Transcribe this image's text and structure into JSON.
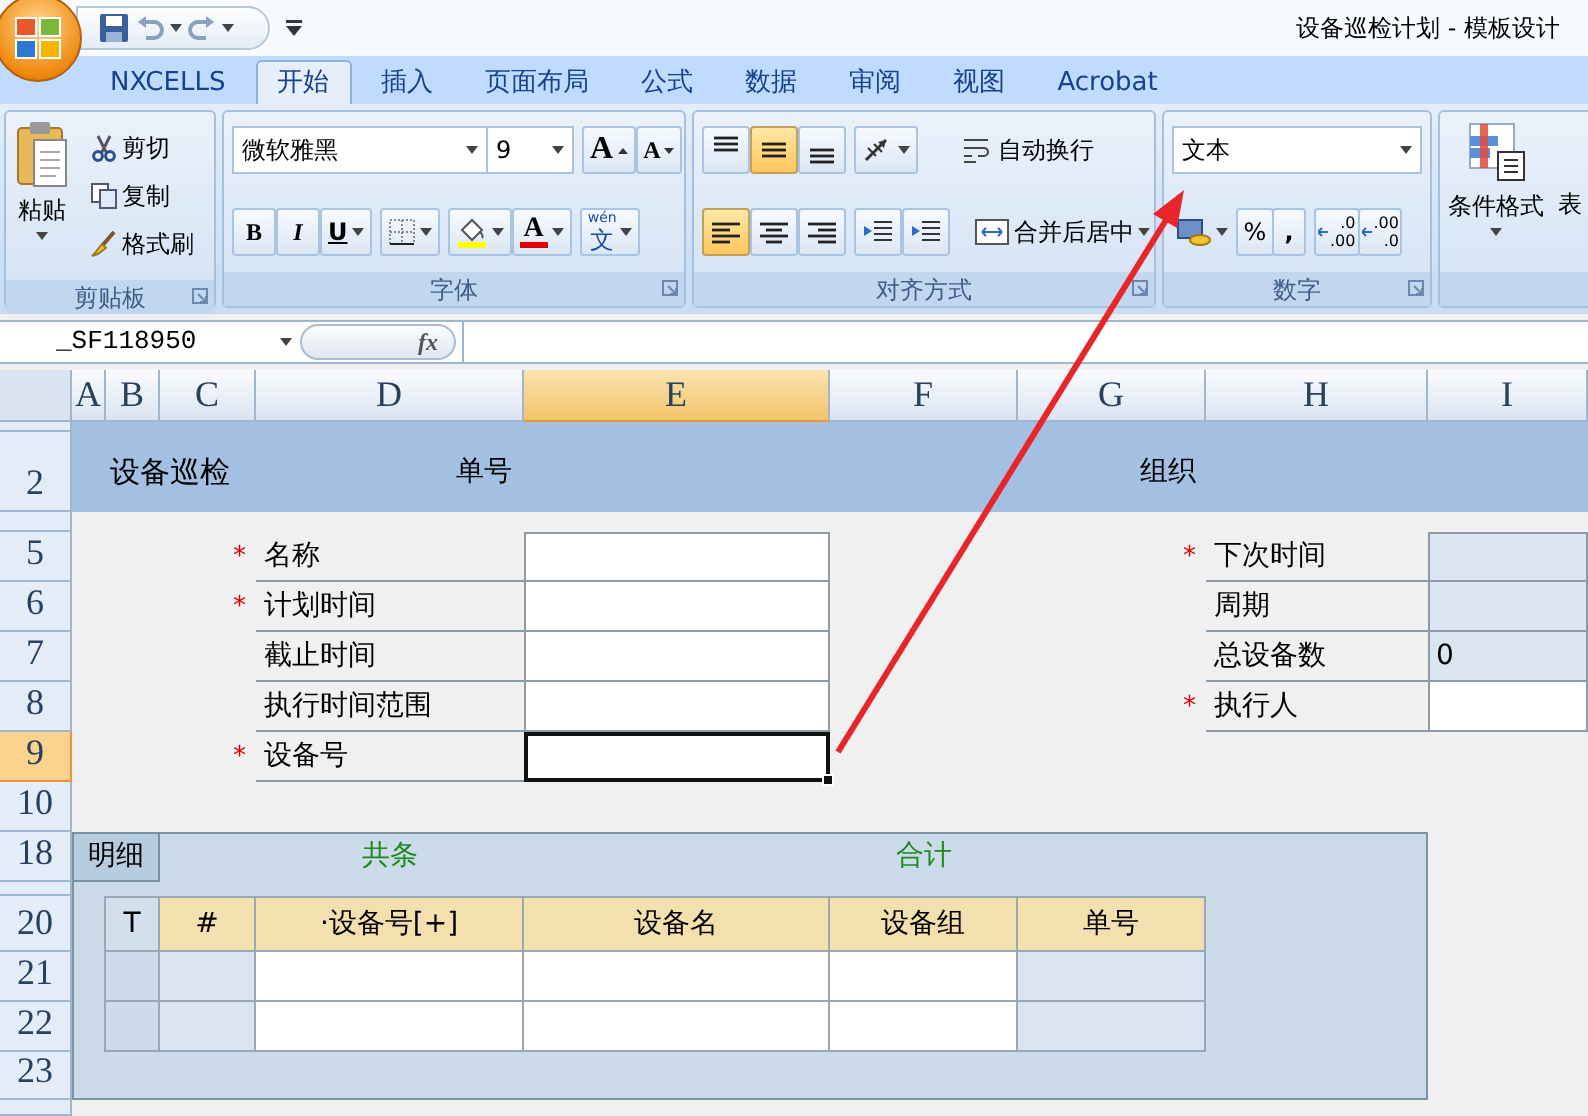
{
  "window": {
    "title": "设备巡检计划 - 模板设计"
  },
  "ribbon_tabs": [
    {
      "label": "NXCELLS",
      "selected": false
    },
    {
      "label": "开始",
      "selected": true
    },
    {
      "label": "插入",
      "selected": false
    },
    {
      "label": "页面布局",
      "selected": false
    },
    {
      "label": "公式",
      "selected": false
    },
    {
      "label": "数据",
      "selected": false
    },
    {
      "label": "审阅",
      "selected": false
    },
    {
      "label": "视图",
      "selected": false
    },
    {
      "label": "Acrobat",
      "selected": false
    }
  ],
  "clipboard": {
    "label": "剪贴板",
    "paste": "粘贴",
    "cut": "剪切",
    "copy": "复制",
    "format_painter": "格式刷"
  },
  "font": {
    "label": "字体",
    "font_name": "微软雅黑",
    "font_size": "9",
    "grow": "A",
    "shrink": "A",
    "bold": "B",
    "italic": "I",
    "underline": "U",
    "font_color": "A",
    "phonetic_top": "wén",
    "phonetic": "文"
  },
  "alignment": {
    "label": "对齐方式",
    "vertical": [
      {
        "kind": "top",
        "selected": false
      },
      {
        "kind": "middle",
        "selected": true
      },
      {
        "kind": "bottom",
        "selected": false
      }
    ],
    "horizontal": [
      {
        "kind": "left",
        "selected": true
      },
      {
        "kind": "center",
        "selected": false
      },
      {
        "kind": "right",
        "selected": false
      }
    ],
    "wrap_text": "自动换行",
    "merge_center": "合并后居中"
  },
  "number": {
    "label": "数字",
    "format": "文本",
    "percent": "%",
    "comma": ",",
    "increase_decimal": [
      ".0",
      ".00"
    ],
    "decrease_decimal": [
      ".00",
      ".0"
    ]
  },
  "styles": {
    "conditional_format": "条件格式",
    "table_format": "表"
  },
  "formula_bar": {
    "name_box": "_SF118950",
    "function_label": "fx"
  },
  "sheet": {
    "columns": [
      {
        "label": "A",
        "selected": false
      },
      {
        "label": "B",
        "selected": false
      },
      {
        "label": "C",
        "selected": false
      },
      {
        "label": "D",
        "selected": false
      },
      {
        "label": "E",
        "selected": true
      },
      {
        "label": "F",
        "selected": false
      },
      {
        "label": "G",
        "selected": false
      },
      {
        "label": "H",
        "selected": false
      },
      {
        "label": "I",
        "selected": false
      }
    ],
    "rows": [
      {
        "label": "2",
        "selected": false
      },
      {
        "label": "5",
        "selected": false
      },
      {
        "label": "6",
        "selected": false
      },
      {
        "label": "7",
        "selected": false
      },
      {
        "label": "8",
        "selected": false
      },
      {
        "label": "9",
        "selected": true
      },
      {
        "label": "10",
        "selected": false
      },
      {
        "label": "18",
        "selected": false
      },
      {
        "label": "20",
        "selected": false
      },
      {
        "label": "21",
        "selected": false
      },
      {
        "label": "22",
        "selected": false
      },
      {
        "label": "23",
        "selected": false
      }
    ],
    "header": {
      "title": "设备巡检",
      "number_label": "单号",
      "org_label": "组织"
    },
    "left_fields": [
      {
        "required_mark": "*",
        "label": "名称",
        "selected": false
      },
      {
        "required_mark": "*",
        "label": "计划时间",
        "selected": false
      },
      {
        "label": "截止时间",
        "selected": false
      },
      {
        "label": "执行时间范围",
        "selected": false
      },
      {
        "required_mark": "*",
        "label": "设备号",
        "selected": true
      }
    ],
    "right_fields": [
      {
        "required_mark": "*",
        "label": "下次时间",
        "readonly": true
      },
      {
        "label": "周期",
        "readonly": true
      },
      {
        "label": "总设备数",
        "readonly": true,
        "value": "0"
      },
      {
        "required_mark": "*",
        "label": "执行人",
        "readonly": false
      }
    ],
    "detail": {
      "tab": "明细",
      "count_label": "共条",
      "total_label": "合计",
      "columns": [
        {
          "label": "T",
          "kind": "marker"
        },
        {
          "label": "#",
          "kind": "index"
        },
        {
          "label": "·设备号[+]",
          "kind": "editable"
        },
        {
          "label": "设备名",
          "kind": "editable"
        },
        {
          "label": "设备组",
          "kind": "editable"
        },
        {
          "label": "单号",
          "kind": "readonly"
        }
      ]
    }
  }
}
